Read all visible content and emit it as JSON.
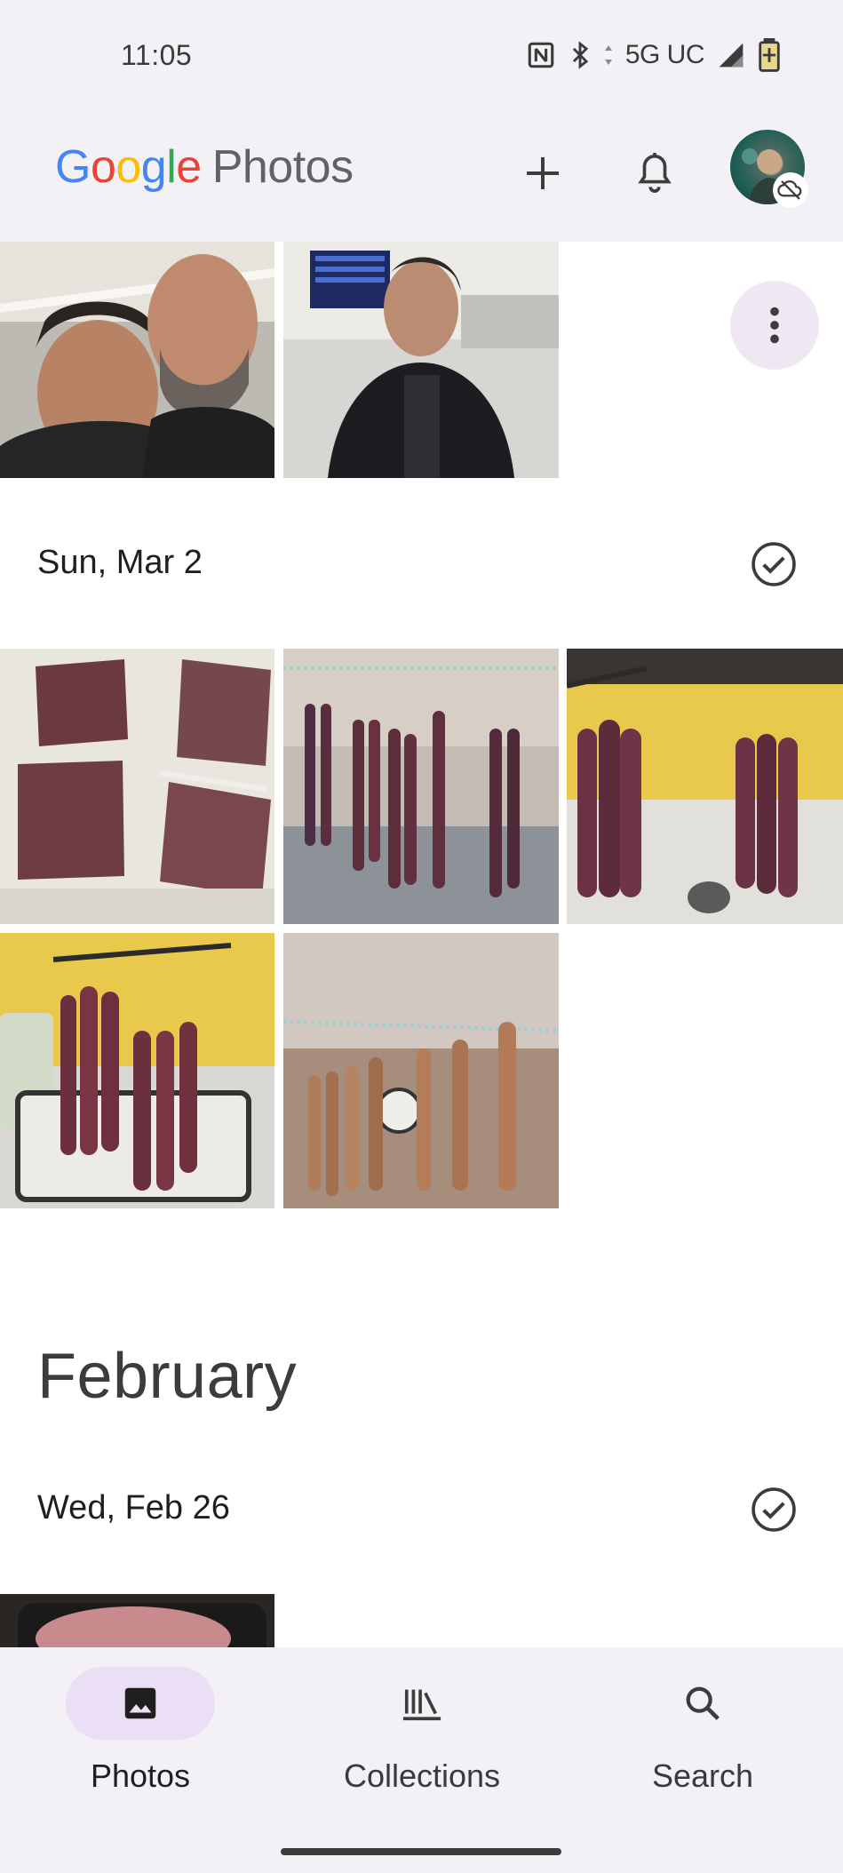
{
  "status_bar": {
    "time": "11:05",
    "network": "5G UC",
    "icons": [
      "nfc-icon",
      "bluetooth-icon",
      "data-arrows-icon",
      "signal-icon",
      "battery-charging-icon"
    ]
  },
  "header": {
    "logo_letters": [
      "G",
      "o",
      "o",
      "g",
      "l",
      "e"
    ],
    "logo_suffix": "Photos",
    "icons": [
      "add-icon",
      "notifications-bell-icon",
      "account-avatar",
      "backup-off-icon"
    ]
  },
  "sections": [
    {
      "date": "",
      "photos": [
        {
          "alt": "Selfie of a woman and a bearded man",
          "tone": "people"
        },
        {
          "alt": "Woman in black jacket at airport terminal",
          "tone": "airport"
        }
      ],
      "more_icon": "more-vert-icon"
    },
    {
      "date": "Sun, Mar 2",
      "photos": [
        {
          "alt": "Vacuum-packed ground meat slabs",
          "tone": "meat"
        },
        {
          "alt": "Sausages hanging in living room",
          "tone": "hanging"
        },
        {
          "alt": "Sausages hanging over sink",
          "tone": "sink"
        },
        {
          "alt": "Sausages drying over kitchen sink",
          "tone": "sink2"
        },
        {
          "alt": "Cured sausages hanging from ceiling",
          "tone": "cured"
        }
      ]
    }
  ],
  "month_heading": "February",
  "next_section": {
    "date": "Wed, Feb 26",
    "photos": [
      {
        "alt": "Ground meat in black pan",
        "tone": "pan"
      }
    ]
  },
  "bottom_nav": {
    "items": [
      {
        "label": "Photos",
        "icon": "photo-icon",
        "active": true
      },
      {
        "label": "Collections",
        "icon": "collections-icon",
        "active": false
      },
      {
        "label": "Search",
        "icon": "search-icon",
        "active": false
      }
    ]
  },
  "colors": {
    "surface": "#f3f1f5",
    "active_pill": "#ebdff5",
    "more_button": "#efe8f3",
    "google_blue": "#4285F4",
    "google_red": "#EA4335",
    "google_yellow": "#FBBC05",
    "google_green": "#34A853"
  }
}
